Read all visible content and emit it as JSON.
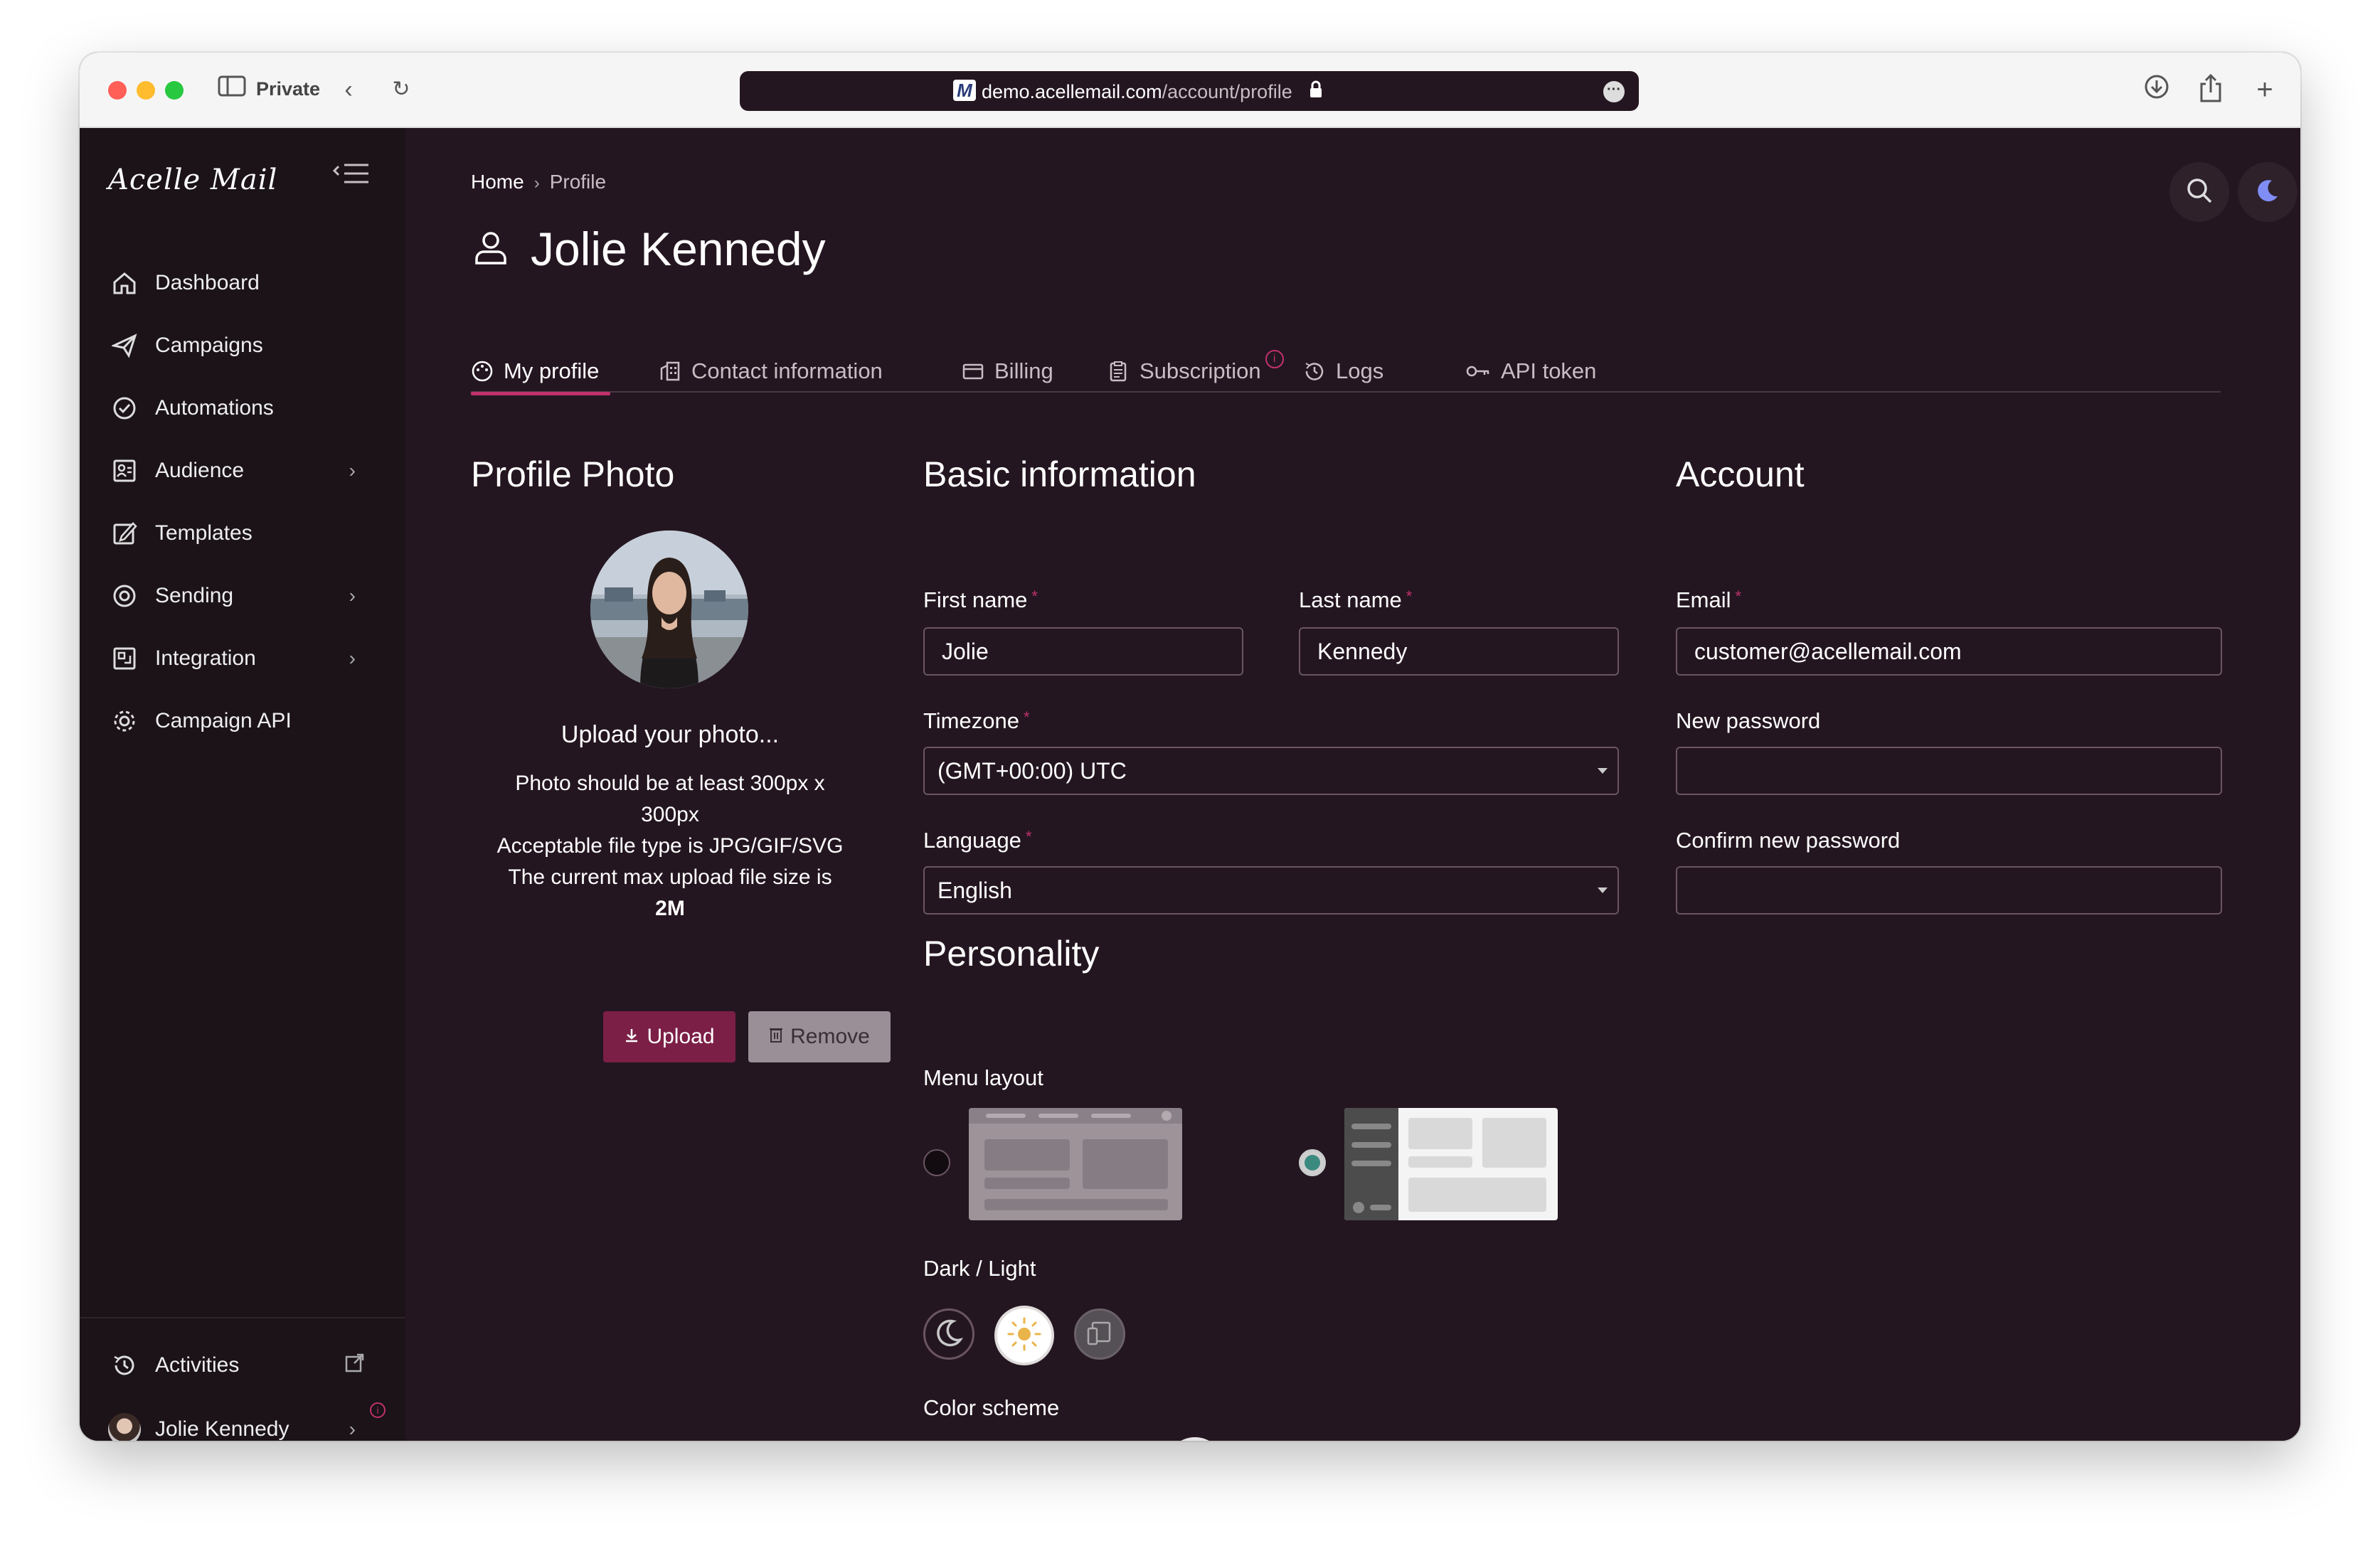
{
  "browser": {
    "private_label": "Private",
    "url_host": "demo.acellemail.com",
    "url_path": "/account/profile"
  },
  "sidebar": {
    "logo": "Acelle Mail",
    "items": [
      {
        "label": "Dashboard",
        "icon": "home-icon",
        "has_submenu": false
      },
      {
        "label": "Campaigns",
        "icon": "paper-plane-icon",
        "has_submenu": false
      },
      {
        "label": "Automations",
        "icon": "automation-icon",
        "has_submenu": false
      },
      {
        "label": "Audience",
        "icon": "audience-icon",
        "has_submenu": true
      },
      {
        "label": "Templates",
        "icon": "template-icon",
        "has_submenu": false
      },
      {
        "label": "Sending",
        "icon": "sending-icon",
        "has_submenu": true
      },
      {
        "label": "Integration",
        "icon": "integration-icon",
        "has_submenu": true
      },
      {
        "label": "Campaign API",
        "icon": "gear-icon",
        "has_submenu": false
      }
    ],
    "activities_label": "Activities",
    "user_name": "Jolie Kennedy"
  },
  "breadcrumb": {
    "home": "Home",
    "current": "Profile"
  },
  "page_title": "Jolie Kennedy",
  "tabs": [
    {
      "label": "My profile",
      "active": true
    },
    {
      "label": "Contact information",
      "active": false
    },
    {
      "label": "Billing",
      "active": false
    },
    {
      "label": "Subscription",
      "active": false,
      "alert": true
    },
    {
      "label": "Logs",
      "active": false
    },
    {
      "label": "API token",
      "active": false
    }
  ],
  "profile_photo": {
    "title": "Profile Photo",
    "upload_prompt": "Upload your photo...",
    "hint_line1": "Photo should be at least 300px x",
    "hint_line2": "300px",
    "hint_line3": "Acceptable file type is JPG/GIF/SVG",
    "hint_line4": "The current max upload file size is",
    "hint_line5": "2M",
    "upload_label": "Upload",
    "remove_label": "Remove"
  },
  "basic_info": {
    "title": "Basic information",
    "first_name_label": "First name",
    "first_name_value": "Jolie",
    "last_name_label": "Last name",
    "last_name_value": "Kennedy",
    "timezone_label": "Timezone",
    "timezone_value": "(GMT+00:00) UTC",
    "language_label": "Language",
    "language_value": "English"
  },
  "account": {
    "title": "Account",
    "email_label": "Email",
    "email_value": "customer@acellemail.com",
    "new_password_label": "New password",
    "new_password_value": "",
    "confirm_password_label": "Confirm new password",
    "confirm_password_value": ""
  },
  "personality": {
    "title": "Personality",
    "menu_layout_label": "Menu layout",
    "menu_layout_selected": "left",
    "dark_light_label": "Dark / Light",
    "dark_light_selected": "light",
    "color_scheme_label": "Color scheme",
    "color_schemes": [
      "#2f8a8f",
      "#1f4f9c",
      "#1d5c4c",
      "#5a3a30",
      "#a0224f",
      "#555555",
      "#f2f2f2"
    ],
    "color_scheme_selected": 4
  },
  "colors": {
    "accent": "#c0326b",
    "bg": "#241620",
    "sidebar_bg": "#1b1318"
  }
}
